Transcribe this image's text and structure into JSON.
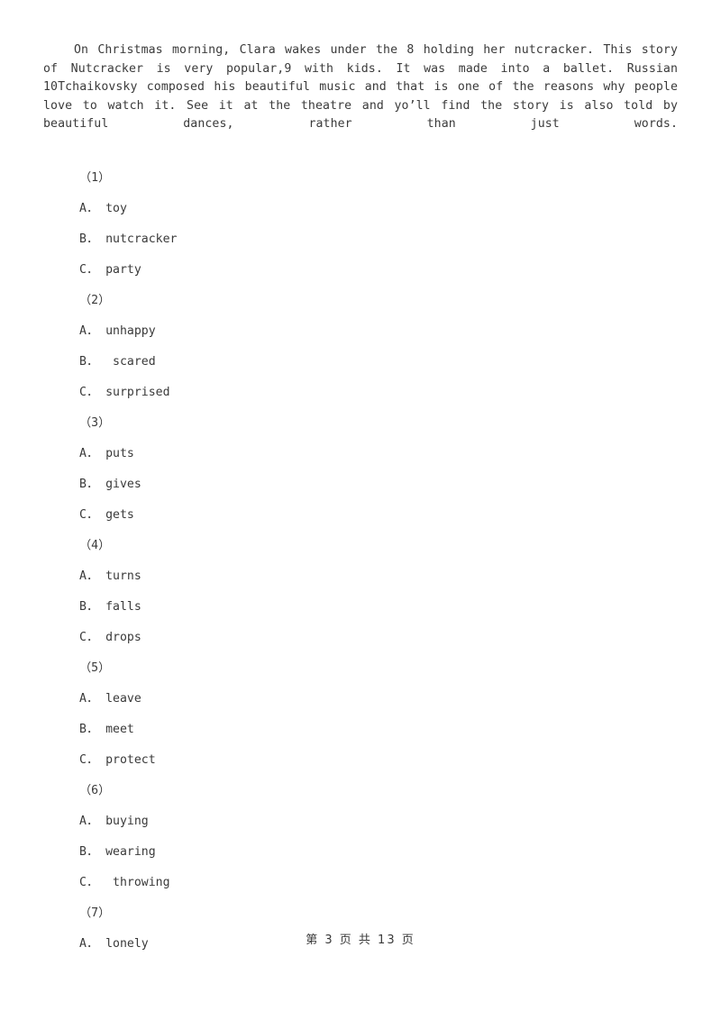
{
  "document": {
    "passage": {
      "text": "On Christmas morning, Clara wakes under the 8 holding her nutcracker. This story of Nutcracker is very popular,9 with kids. It was made into a ballet. Russian 10Tchaikovsky composed his beautiful music and that is one of the reasons why people love to watch it. See it at the theatre and yo’ll find the story is also told by beautiful dances, rather than just words."
    },
    "questions": [
      {
        "number": "（1）",
        "options": [
          "A． toy",
          "B． nutcracker",
          "C． party"
        ]
      },
      {
        "number": "（2）",
        "options": [
          "A． unhappy",
          "B．  scared",
          "C． surprised"
        ]
      },
      {
        "number": "（3）",
        "options": [
          "A． puts",
          "B． gives",
          "C． gets"
        ]
      },
      {
        "number": "（4）",
        "options": [
          "A． turns",
          "B． falls",
          "C． drops"
        ]
      },
      {
        "number": "（5）",
        "options": [
          "A． leave",
          "B． meet",
          "C． protect"
        ]
      },
      {
        "number": "（6）",
        "options": [
          "A． buying",
          "B． wearing",
          "C．  throwing"
        ]
      },
      {
        "number": "（7）",
        "options": [
          "A． lonely"
        ]
      }
    ],
    "footer": {
      "text": "第 3 页 共 13 页",
      "current_page": "3",
      "total_pages": "13"
    }
  }
}
